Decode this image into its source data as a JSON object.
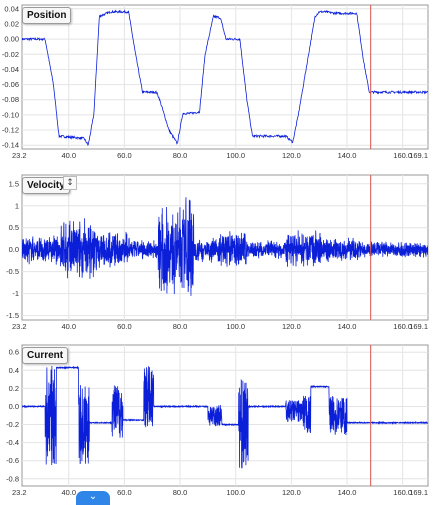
{
  "colors": {
    "trace": "#0b1fd9",
    "grid": "#e4e4e4",
    "axis": "#999999",
    "cursor": "#d9534f"
  },
  "ui": {
    "collapse_icon": "chevron-down-icon",
    "collapse_glyph": "⌄",
    "resize_icon": "vertical-resize-icon",
    "resize_glyph": "↕"
  },
  "chart_data": [
    {
      "type": "line",
      "title": "Position",
      "xlabel": "",
      "ylabel": "",
      "xlim": [
        23.2,
        169.1
      ],
      "ylim": [
        -0.145,
        0.045
      ],
      "x_ticks": [
        "23.2",
        "40.0",
        "60.0",
        "80.0",
        "100.0",
        "120.0",
        "140.0",
        "160.0",
        "169.1"
      ],
      "y_ticks": [
        "0.04",
        "0.02",
        "0.00",
        "-0.02",
        "-0.04",
        "-0.06",
        "-0.08",
        "-0.10",
        "-0.12",
        "-0.14"
      ],
      "cursor_x": 148.5,
      "grid": true,
      "series": [
        {
          "noise": 0.0015,
          "x": [
            23.2,
            31.5,
            34.5,
            36.5,
            45.5,
            47.0,
            49.0,
            51.0,
            55.0,
            61.5,
            64.0,
            66.5,
            71.5,
            72.5,
            76.0,
            79.0,
            81.0,
            84.0,
            87.0,
            89.0,
            92.0,
            94.5,
            96.5,
            101.5,
            104.0,
            106.0,
            118.0,
            120.5,
            122.5,
            128.5,
            130.0,
            132.0,
            136.0,
            143.5,
            146.0,
            148.0,
            169.1
          ],
          "y": [
            0.0,
            0.0,
            -0.06,
            -0.128,
            -0.131,
            -0.14,
            -0.1,
            0.03,
            0.036,
            0.036,
            -0.02,
            -0.07,
            -0.07,
            -0.078,
            -0.12,
            -0.138,
            -0.098,
            -0.098,
            -0.096,
            -0.02,
            0.03,
            0.028,
            0.0,
            0.0,
            -0.08,
            -0.128,
            -0.128,
            -0.136,
            -0.1,
            0.03,
            0.036,
            0.036,
            0.034,
            0.034,
            -0.03,
            -0.07,
            -0.07
          ]
        }
      ]
    },
    {
      "type": "line",
      "title": "Velocity",
      "xlabel": "",
      "ylabel": "",
      "xlim": [
        23.2,
        169.1
      ],
      "ylim": [
        -1.6,
        1.7
      ],
      "x_ticks": [
        "23.2",
        "40.0",
        "60.0",
        "80.0",
        "100.0",
        "120.0",
        "140.0",
        "160.0",
        "169.1"
      ],
      "y_ticks": [
        "1.5",
        "1",
        "0.5",
        "0.0",
        "-0.5",
        "-1",
        "-1.5"
      ],
      "cursor_x": 148.5,
      "grid": true,
      "series": [
        {
          "envelope": [
            {
              "x0": 23.2,
              "x1": 37.0,
              "amp": 0.35
            },
            {
              "x0": 37.0,
              "x1": 50.0,
              "amp": 0.75
            },
            {
              "x0": 50.0,
              "x1": 62.0,
              "amp": 0.45
            },
            {
              "x0": 62.0,
              "x1": 72.0,
              "amp": 0.25
            },
            {
              "x0": 72.0,
              "x1": 82.0,
              "amp": 1.05
            },
            {
              "x0": 82.0,
              "x1": 85.0,
              "amp": 1.5
            },
            {
              "x0": 85.0,
              "x1": 94.0,
              "amp": 0.3
            },
            {
              "x0": 94.0,
              "x1": 104.0,
              "amp": 0.45
            },
            {
              "x0": 104.0,
              "x1": 118.0,
              "amp": 0.22
            },
            {
              "x0": 118.0,
              "x1": 131.0,
              "amp": 0.45
            },
            {
              "x0": 131.0,
              "x1": 145.0,
              "amp": 0.3
            },
            {
              "x0": 145.0,
              "x1": 169.1,
              "amp": 0.2
            }
          ]
        }
      ]
    },
    {
      "type": "line",
      "title": "Current",
      "xlabel": "",
      "ylabel": "",
      "xlim": [
        23.2,
        169.1
      ],
      "ylim": [
        -0.88,
        0.68
      ],
      "x_ticks": [
        "23.2",
        "40.0",
        "60.0",
        "80.0",
        "100.0",
        "120.0",
        "140.0",
        "160.0",
        "169.1"
      ],
      "y_ticks": [
        "0.6",
        "0.4",
        "0.2",
        "0.0",
        "-0.2",
        "-0.4",
        "-0.6",
        "-0.8"
      ],
      "cursor_x": 148.5,
      "grid": true,
      "series": [
        {
          "segments": [
            {
              "x0": 23.2,
              "x1": 31.5,
              "level": 0.0,
              "amp": 0.0
            },
            {
              "x0": 31.5,
              "x1": 35.5,
              "level": -0.1,
              "amp": 0.55
            },
            {
              "x0": 35.5,
              "x1": 43.5,
              "level": 0.43,
              "amp": 0.0
            },
            {
              "x0": 43.5,
              "x1": 47.5,
              "level": -0.2,
              "amp": 0.45
            },
            {
              "x0": 47.5,
              "x1": 55.5,
              "level": -0.18,
              "amp": 0.0
            },
            {
              "x0": 55.5,
              "x1": 59.5,
              "level": -0.05,
              "amp": 0.3
            },
            {
              "x0": 59.5,
              "x1": 67.0,
              "level": -0.15,
              "amp": 0.0
            },
            {
              "x0": 67.0,
              "x1": 70.5,
              "level": 0.1,
              "amp": 0.35
            },
            {
              "x0": 70.5,
              "x1": 78.0,
              "level": 0.0,
              "amp": 0.0
            },
            {
              "x0": 78.0,
              "x1": 90.0,
              "level": 0.0,
              "amp": 0.0
            },
            {
              "x0": 90.0,
              "x1": 95.0,
              "level": -0.1,
              "amp": 0.12
            },
            {
              "x0": 95.0,
              "x1": 101.0,
              "level": -0.2,
              "amp": 0.0
            },
            {
              "x0": 101.0,
              "x1": 104.5,
              "level": -0.2,
              "amp": 0.5
            },
            {
              "x0": 104.5,
              "x1": 118.0,
              "level": 0.0,
              "amp": 0.0
            },
            {
              "x0": 118.0,
              "x1": 124.0,
              "level": -0.05,
              "amp": 0.12
            },
            {
              "x0": 124.0,
              "x1": 127.0,
              "level": -0.1,
              "amp": 0.22
            },
            {
              "x0": 127.0,
              "x1": 133.5,
              "level": 0.22,
              "amp": 0.0
            },
            {
              "x0": 133.5,
              "x1": 140.0,
              "level": -0.1,
              "amp": 0.22
            },
            {
              "x0": 140.0,
              "x1": 169.1,
              "level": -0.18,
              "amp": 0.0
            }
          ]
        }
      ]
    }
  ]
}
